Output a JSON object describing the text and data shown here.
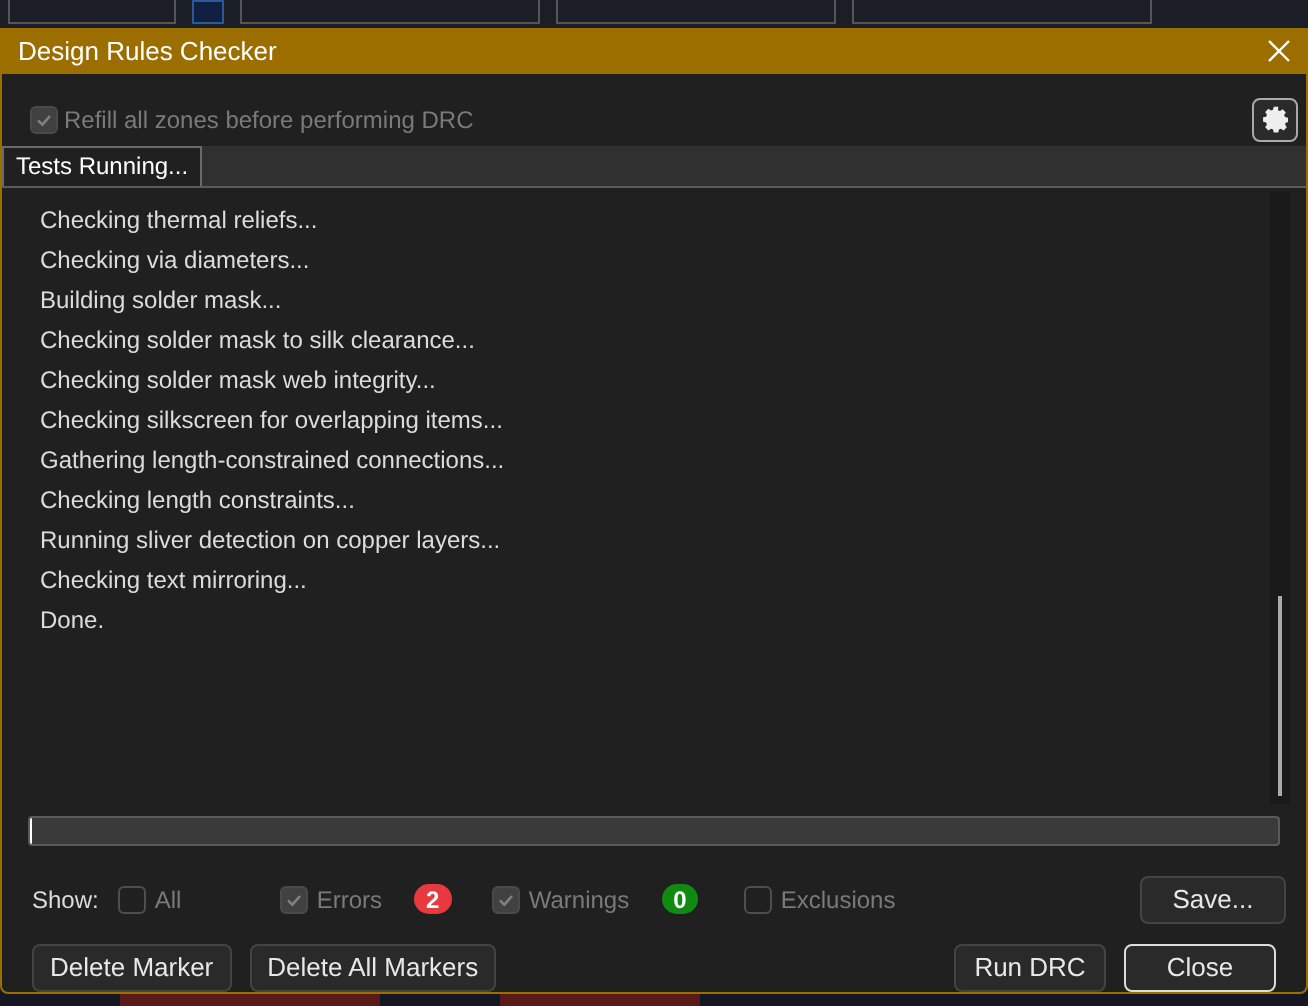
{
  "window": {
    "title": "Design Rules Checker"
  },
  "refill_option": {
    "label": "Refill all zones before performing DRC",
    "checked": true,
    "disabled": true
  },
  "tabs": [
    {
      "label": "Tests Running...",
      "selected": true
    }
  ],
  "log_lines": [
    "Checking thermal reliefs...",
    "Checking via diameters...",
    "Building solder mask...",
    "Checking solder mask to silk clearance...",
    "Checking solder mask web integrity...",
    "Checking silkscreen for overlapping items...",
    "Gathering length-constrained connections...",
    "Checking length constraints...",
    "Running sliver detection on copper layers...",
    "Checking text mirroring...",
    "Done."
  ],
  "progress": {
    "level": 0.002
  },
  "show_filter": {
    "label": "Show:",
    "options": [
      {
        "label": "All",
        "checked": false,
        "disabled": true
      },
      {
        "label": "Errors",
        "checked": true,
        "disabled": true,
        "count": "2",
        "color": "#e8393f"
      },
      {
        "label": "Warnings",
        "checked": true,
        "disabled": true,
        "count": "0",
        "color": "#108a10"
      },
      {
        "label": "Exclusions",
        "checked": false,
        "disabled": true
      }
    ]
  },
  "save_button": "Save...",
  "left_buttons": [
    "Delete Marker",
    "Delete All Markers"
  ],
  "right_buttons": [
    {
      "label": "Run DRC",
      "default": false
    },
    {
      "label": "Close",
      "default": true
    }
  ]
}
